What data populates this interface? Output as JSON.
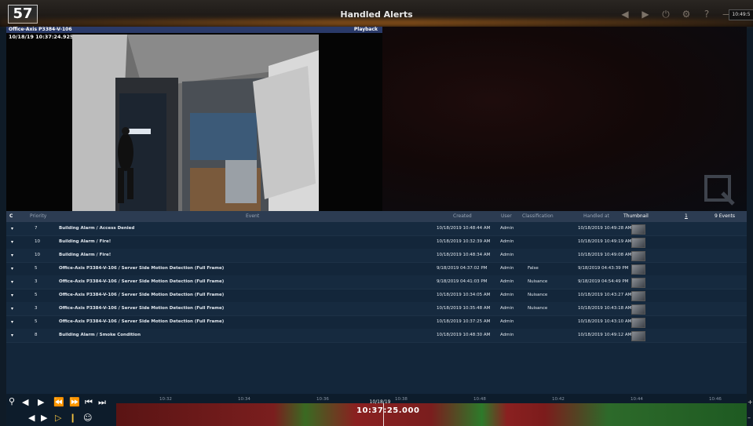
{
  "app": {
    "logo_text": "57",
    "title": "Handled Alerts",
    "clock": "10:49:5"
  },
  "toolbar": {
    "icons": [
      "back-arrow-icon",
      "forward-arrow-icon",
      "power-icon",
      "gear-icon",
      "help-icon",
      "minimize-icon",
      "maximize-icon"
    ]
  },
  "camera": {
    "name": "Office-Axis P3384-V-106",
    "mode": "Playback",
    "timestamp": "10/18/19 10:37:24.925"
  },
  "table": {
    "headers": {
      "c": "C",
      "priority": "Priority",
      "event": "Event",
      "created": "Created",
      "user": "User",
      "classification": "Classification",
      "handled_at": "Handled at",
      "thumbnail": "Thumbnail",
      "page": "1",
      "count": "9 Events"
    },
    "rows": [
      {
        "priority": "7",
        "event": "Building Alarm / Access Denied",
        "created": "10/18/2019 10:48:44 AM",
        "user": "Admin",
        "classification": "",
        "handled_at": "10/18/2019 10:49:28 AM"
      },
      {
        "priority": "10",
        "event": "Building Alarm / Fire!",
        "created": "10/18/2019 10:32:39 AM",
        "user": "Admin",
        "classification": "",
        "handled_at": "10/18/2019 10:49:19 AM"
      },
      {
        "priority": "10",
        "event": "Building Alarm / Fire!",
        "created": "10/18/2019 10:48:34 AM",
        "user": "Admin",
        "classification": "",
        "handled_at": "10/18/2019 10:49:08 AM"
      },
      {
        "priority": "5",
        "event": "Office-Axis P3384-V-106 / Server Side Motion Detection (Full Frame)",
        "created": "9/18/2019 04:37:02 PM",
        "user": "Admin",
        "classification": "False",
        "handled_at": "9/18/2019 04:43:39 PM"
      },
      {
        "priority": "3",
        "event": "Office-Axis P3384-V-106 / Server Side Motion Detection (Full Frame)",
        "created": "9/18/2019 04:41:03 PM",
        "user": "Admin",
        "classification": "Nuisance",
        "handled_at": "9/18/2019 04:54:49 PM"
      },
      {
        "priority": "5",
        "event": "Office-Axis P3384-V-106 / Server Side Motion Detection (Full Frame)",
        "created": "10/18/2019 10:34:05 AM",
        "user": "Admin",
        "classification": "Nuisance",
        "handled_at": "10/18/2019 10:43:27 AM"
      },
      {
        "priority": "3",
        "event": "Office-Axis P3384-V-106 / Server Side Motion Detection (Full Frame)",
        "created": "10/18/2019 10:35:48 AM",
        "user": "Admin",
        "classification": "Nuisance",
        "handled_at": "10/18/2019 10:43:18 AM"
      },
      {
        "priority": "5",
        "event": "Office-Axis P3384-V-106 / Server Side Motion Detection (Full Frame)",
        "created": "10/18/2019 10:37:25 AM",
        "user": "Admin",
        "classification": "",
        "handled_at": "10/18/2019 10:43:10 AM"
      },
      {
        "priority": "8",
        "event": "Building Alarm / Smoke Condition",
        "created": "10/18/2019 10:48:30 AM",
        "user": "Admin",
        "classification": "",
        "handled_at": "10/18/2019 10:49:12 AM"
      }
    ]
  },
  "timeline": {
    "ticks": [
      "10:32",
      "10:34",
      "10:36",
      "10:38",
      "10:48",
      "10:42",
      "10:44",
      "10:46"
    ],
    "date": "10/18/19",
    "time": "10:37:25.000"
  }
}
